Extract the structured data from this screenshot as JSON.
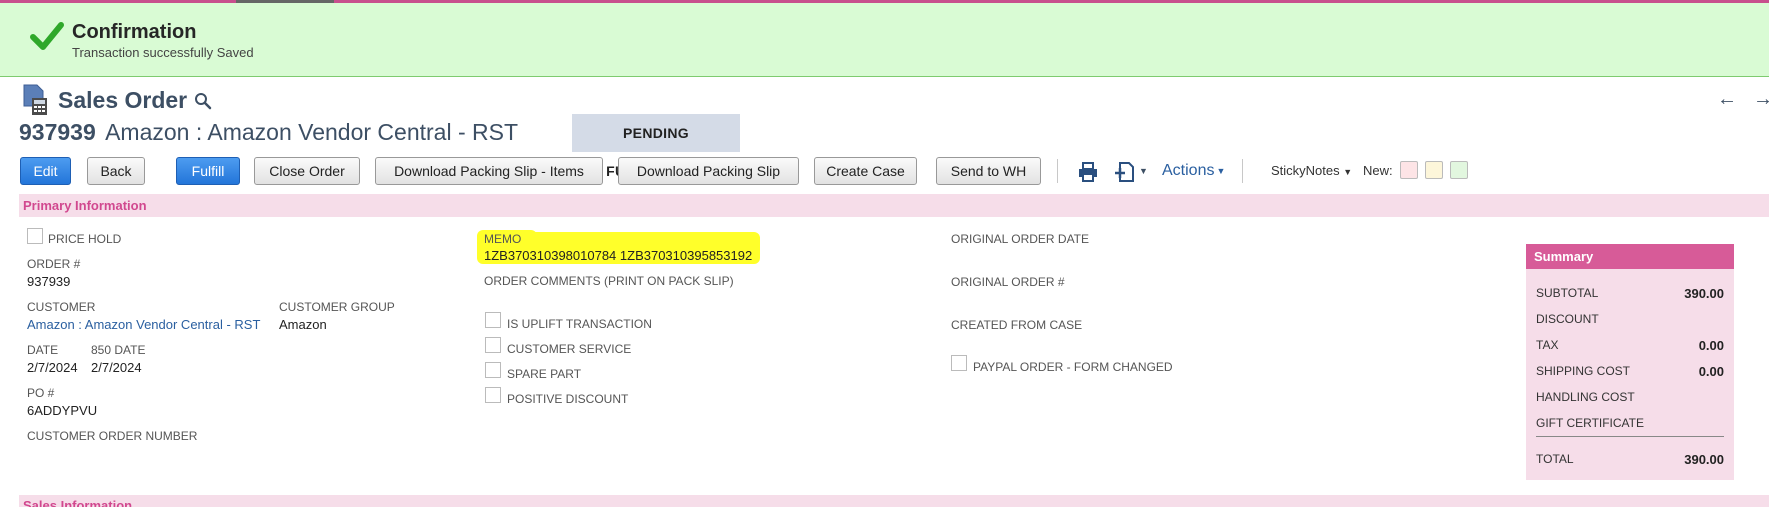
{
  "confirmation": {
    "title": "Confirmation",
    "message": "Transaction successfully Saved"
  },
  "page": {
    "title": "Sales Order",
    "record_number": "937939",
    "record_name": "Amazon : Amazon Vendor Central - RST",
    "status": "PENDING FULFILLMENT"
  },
  "toolbar": {
    "edit": "Edit",
    "back": "Back",
    "fulfill": "Fulfill",
    "close_order": "Close Order",
    "download_packing_slip_items": "Download Packing Slip - Items",
    "download_packing_slip": "Download Packing Slip",
    "create_case": "Create Case",
    "send_to_wh": "Send to WH",
    "actions": "Actions",
    "sticky_notes": "StickyNotes",
    "new_label": "New:",
    "swatch_colors": [
      "#fde4e6",
      "#fdf6da",
      "#e2f7df"
    ]
  },
  "primary": {
    "section_title": "Primary Information",
    "price_hold": "PRICE HOLD",
    "order_no_label": "ORDER #",
    "order_no": "937939",
    "customer_label": "CUSTOMER",
    "customer": "Amazon : Amazon Vendor Central - RST",
    "customer_group_label": "CUSTOMER GROUP",
    "customer_group": "Amazon",
    "date_label": "DATE",
    "date": "2/7/2024",
    "date_850_label": "850 DATE",
    "date_850": "2/7/2024",
    "po_label": "PO #",
    "po": "6ADDYPVU",
    "customer_order_number_label": "CUSTOMER ORDER NUMBER",
    "memo_label": "MEMO",
    "memo": "1ZB370310398010784 1ZB370310395853192",
    "order_comments_label": "ORDER COMMENTS (PRINT ON PACK SLIP)",
    "is_uplift": "IS UPLIFT TRANSACTION",
    "customer_service": "CUSTOMER SERVICE",
    "spare_part": "SPARE PART",
    "positive_discount": "POSITIVE DISCOUNT",
    "original_order_date_label": "ORIGINAL ORDER DATE",
    "original_order_no_label": "ORIGINAL ORDER #",
    "created_from_case_label": "CREATED FROM CASE",
    "paypal_order": "PAYPAL ORDER - FORM CHANGED"
  },
  "summary": {
    "title": "Summary",
    "subtotal_label": "SUBTOTAL",
    "subtotal": "390.00",
    "discount_label": "DISCOUNT",
    "tax_label": "TAX",
    "tax": "0.00",
    "shipping_label": "SHIPPING COST",
    "shipping": "0.00",
    "handling_label": "HANDLING COST",
    "gift_label": "GIFT CERTIFICATE",
    "total_label": "TOTAL",
    "total": "390.00"
  },
  "sales_section": {
    "title": "Sales Information"
  }
}
